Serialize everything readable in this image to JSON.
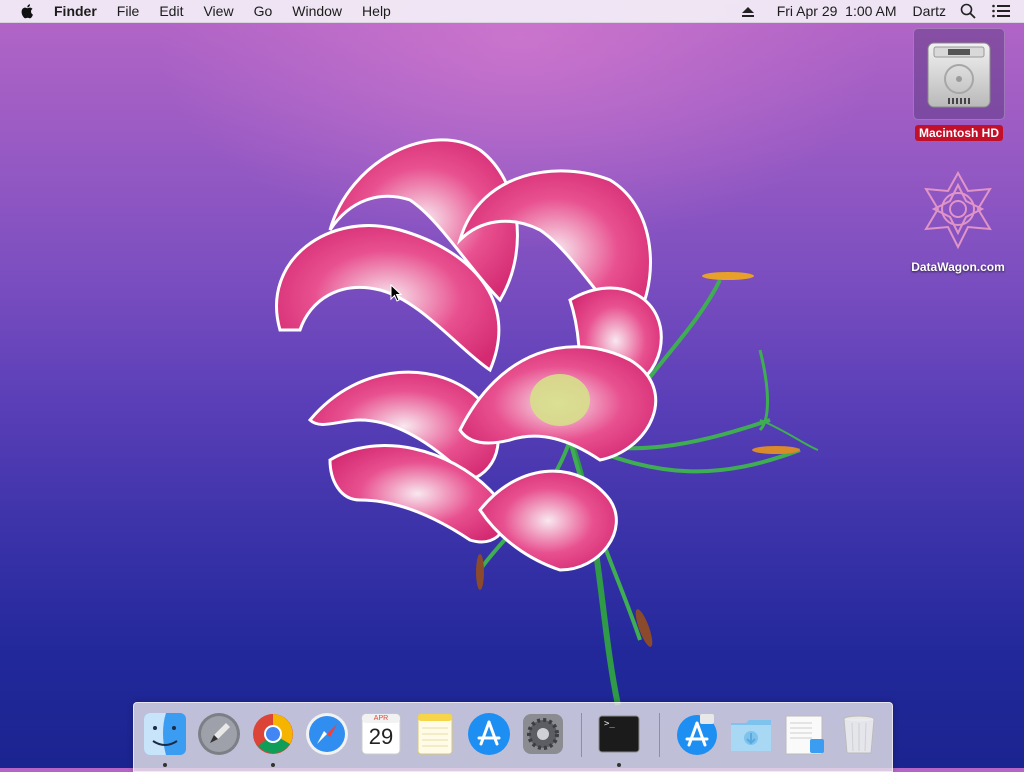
{
  "menubar": {
    "app_name": "Finder",
    "menus": [
      "File",
      "Edit",
      "View",
      "Go",
      "Window",
      "Help"
    ],
    "clock": "Fri Apr 29  1:00 AM",
    "user": "Dartz"
  },
  "desktop": {
    "icons": [
      {
        "label": "Macintosh HD",
        "icon": "hard-drive-icon",
        "selected": true
      },
      {
        "label": "DataWagon.com",
        "icon": "datawagon-volume-icon",
        "selected": false
      }
    ]
  },
  "dock": {
    "apps": [
      {
        "name": "Finder",
        "icon": "finder-icon",
        "running": true
      },
      {
        "name": "Launchpad",
        "icon": "launchpad-icon",
        "running": false
      },
      {
        "name": "Google Chrome",
        "icon": "chrome-icon",
        "running": true
      },
      {
        "name": "Safari",
        "icon": "safari-icon",
        "running": false
      },
      {
        "name": "Calendar",
        "icon": "calendar-icon",
        "running": false,
        "month": "APR",
        "day": "29"
      },
      {
        "name": "Notes",
        "icon": "notes-icon",
        "running": false
      },
      {
        "name": "App Store",
        "icon": "app-store-icon",
        "running": false
      },
      {
        "name": "System Preferences",
        "icon": "system-preferences-icon",
        "running": false
      },
      {
        "name": "Terminal",
        "icon": "terminal-icon",
        "running": true
      },
      {
        "name": "App Store Downloads",
        "icon": "app-store-downloads-icon",
        "running": false
      },
      {
        "name": "Downloads",
        "icon": "downloads-folder-icon",
        "running": false
      },
      {
        "name": "Documents",
        "icon": "documents-stack-icon",
        "running": false
      },
      {
        "name": "Trash",
        "icon": "trash-icon",
        "running": false
      }
    ],
    "terminal_prompt": ">_"
  },
  "colors": {
    "selection_label": "#c3102a",
    "wallpaper_top": "#b566c6",
    "wallpaper_bottom": "#1a2490",
    "petal": "#e23d86"
  }
}
